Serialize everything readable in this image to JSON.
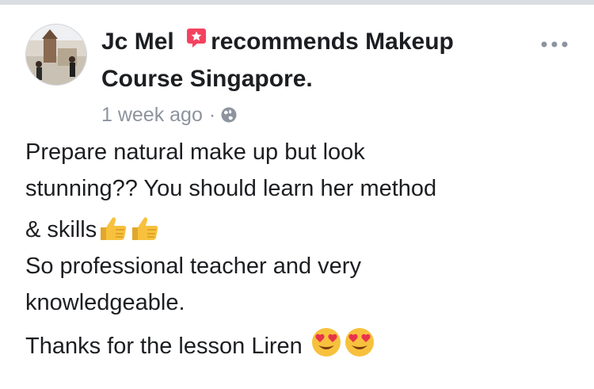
{
  "post": {
    "author": "Jc Mel",
    "verb": "recommends",
    "page_name_line1": "Makeup",
    "page_name_line2": "Course Singapore.",
    "time": "1 week ago",
    "separator": "·",
    "privacy_icon": "globe-icon",
    "more_icon": "more-options-icon",
    "badge_icon": "recommendation-star-badge",
    "colors": {
      "badge": "#f3425f",
      "meta": "#8d949e",
      "text": "#1c1e21"
    }
  },
  "review": {
    "line1": "Prepare natural make up but look",
    "line2": "stunning?? You should learn her method",
    "line3": "& skills",
    "line3_emoji": "thumbs-up x2",
    "line4": "So professional teacher and very",
    "line5": "knowledgeable.",
    "line6": "Thanks for the lesson Liren ",
    "line6_emoji": "heart-eyes x2"
  }
}
